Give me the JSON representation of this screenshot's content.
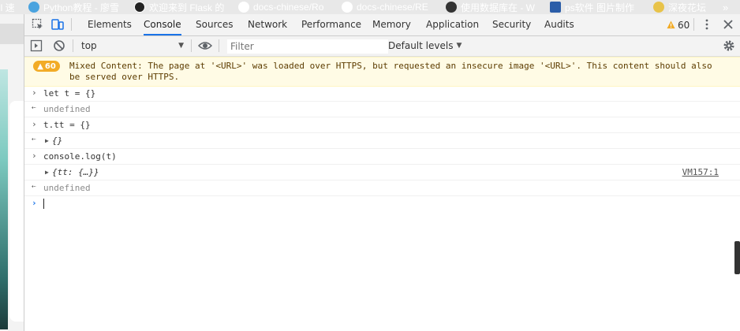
{
  "bookmarks": [
    {
      "label": "il 速",
      "icon": "",
      "color": "#e8e8e8"
    },
    {
      "label": "Python教程 - 廖雪",
      "icon": "bird-icon",
      "color": "#4aa3df"
    },
    {
      "label": "欢迎来到 Flask 的",
      "icon": "flask-icon",
      "color": "#222222"
    },
    {
      "label": "docs-chinese/Ro",
      "icon": "github-icon",
      "color": "#ffffff"
    },
    {
      "label": "docs-chinese/RE",
      "icon": "github-icon",
      "color": "#ffffff"
    },
    {
      "label": "使用数据库在 - W",
      "icon": "w-icon",
      "color": "#333333"
    },
    {
      "label": "ps软件 图片制作",
      "icon": "ps-icon",
      "color": "#2b5da8"
    },
    {
      "label": "深夜花坛",
      "icon": "flower-icon",
      "color": "#e8c34a"
    }
  ],
  "overflow_label": "»",
  "devtools": {
    "tabs": [
      "Elements",
      "Console",
      "Sources",
      "Network",
      "Performance",
      "Memory",
      "Application",
      "Security",
      "Audits"
    ],
    "active_tab": "Console",
    "warning_count": "60"
  },
  "toolbar": {
    "context": "top",
    "filter_placeholder": "Filter",
    "levels": "Default levels"
  },
  "console": {
    "warning": {
      "badge": "60",
      "text": "Mixed Content: The page at '<URL>' was loaded over HTTPS, but requested an insecure image '<URL>'. This content should also be served over HTTPS."
    },
    "lines": [
      {
        "kind": "input",
        "text": "let t = {}"
      },
      {
        "kind": "result",
        "text": "undefined"
      },
      {
        "kind": "input",
        "text": "t.tt = {}"
      },
      {
        "kind": "object",
        "text": "{}"
      },
      {
        "kind": "input",
        "text": "console.log(t)"
      },
      {
        "kind": "log",
        "text": "{tt: {…}}",
        "source": "VM157:1"
      },
      {
        "kind": "result",
        "text": "undefined"
      }
    ]
  },
  "colors": {
    "accent": "#1a73e8",
    "warning": "#f2ab26",
    "warning_bg": "#fffbe5"
  }
}
